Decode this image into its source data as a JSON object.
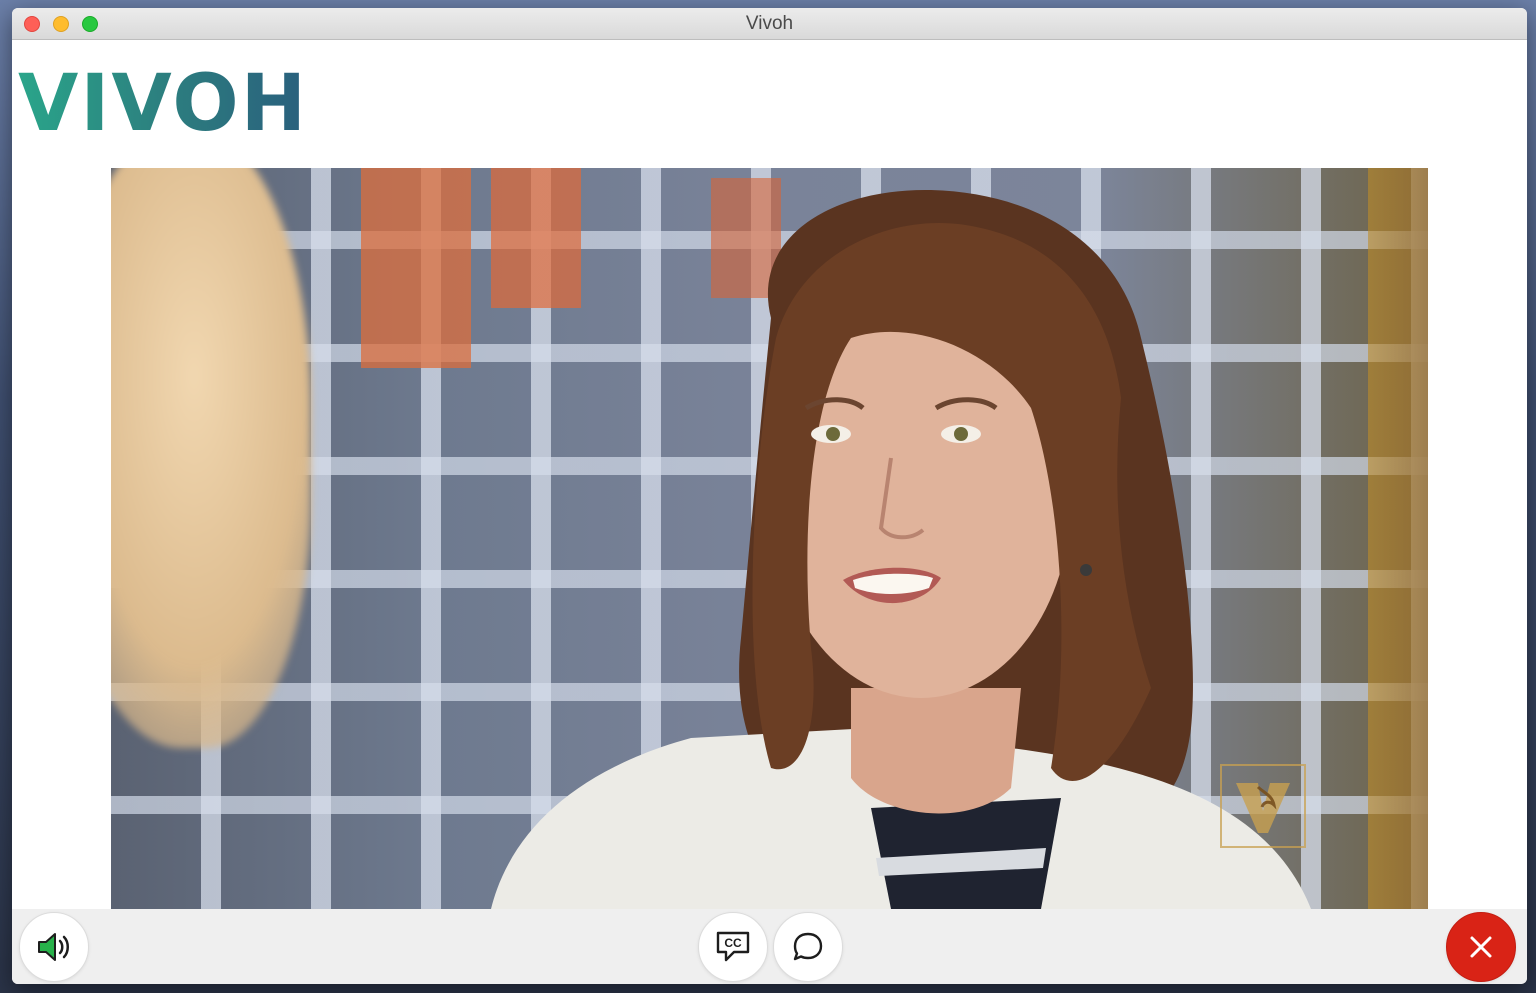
{
  "window": {
    "title": "Vivoh"
  },
  "logo": {
    "text": "VIVOH"
  },
  "video": {
    "watermark": "vanderbilt-v-logo"
  },
  "controls": {
    "sound_icon": "speaker-volume-icon",
    "cc_icon": "closed-captions-icon",
    "cc_label": "CC",
    "chat_icon": "chat-bubble-icon",
    "close_icon": "close-icon"
  },
  "colors": {
    "brand_teal": "#2aa58a",
    "brand_blue": "#2a5f7d",
    "close_red": "#d92316",
    "sound_green": "#27b14a"
  }
}
